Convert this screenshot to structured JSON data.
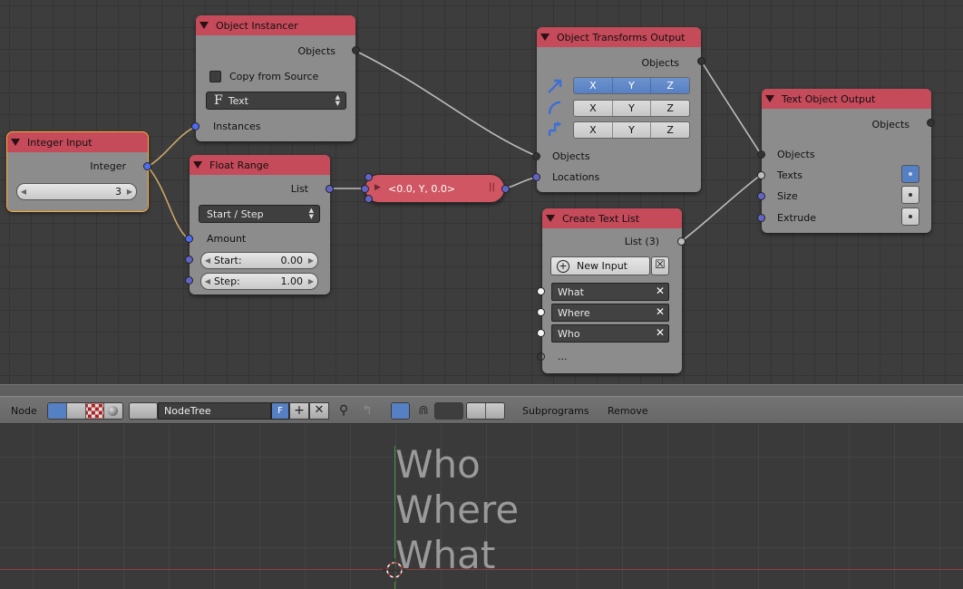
{
  "nodes": {
    "integer_input": {
      "title": "Integer Input",
      "output": "Integer",
      "value": "3"
    },
    "object_instancer": {
      "title": "Object Instancer",
      "output": "Objects",
      "copy_from_source": "Copy from Source",
      "type_icon": "F",
      "type": "Text",
      "input": "Instances"
    },
    "float_range": {
      "title": "Float Range",
      "output": "List",
      "mode": "Start / Step",
      "amount": "Amount",
      "start_label": "Start:",
      "start_value": "0.00",
      "step_label": "Step:",
      "step_value": "1.00"
    },
    "reroute": {
      "label": "<0.0, Y, 0.0>"
    },
    "object_transforms_output": {
      "title": "Object Transforms Output",
      "output": "Objects",
      "axes": [
        "X",
        "Y",
        "Z"
      ],
      "input_objects": "Objects",
      "input_locations": "Locations"
    },
    "create_text_list": {
      "title": "Create Text List",
      "output": "List (3)",
      "new_input": "New Input",
      "items": [
        "What",
        "Where",
        "Who"
      ],
      "more": "..."
    },
    "text_object_output": {
      "title": "Text Object Output",
      "output": "Objects",
      "inputs": [
        "Objects",
        "Texts",
        "Size",
        "Extrude"
      ]
    }
  },
  "header": {
    "editor_menu": "Node",
    "tree_name": "NodeTree",
    "fake_user": "F",
    "subprograms": "Subprograms",
    "remove": "Remove"
  },
  "viewport": {
    "lines": [
      "Who",
      "Where",
      "What"
    ]
  },
  "colors": {
    "node_header": "#c54a5a",
    "node_body": "#8c8c8c",
    "selected_outline": "#ffaa33",
    "link": "#bdbdbd",
    "accent_blue": "#5680c4"
  }
}
